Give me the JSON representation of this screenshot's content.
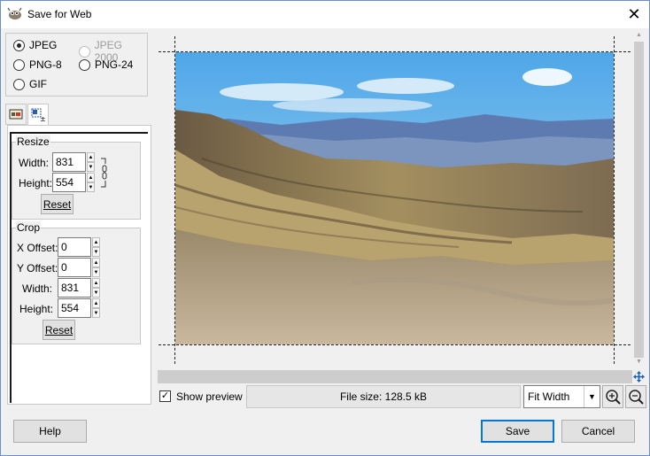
{
  "window": {
    "title": "Save for Web"
  },
  "format": {
    "options": [
      {
        "label": "JPEG",
        "checked": true,
        "disabled": false
      },
      {
        "label": "JPEG 2000",
        "checked": false,
        "disabled": true
      },
      {
        "label": "PNG-8",
        "checked": false,
        "disabled": false
      },
      {
        "label": "PNG-24",
        "checked": false,
        "disabled": false
      },
      {
        "label": "GIF",
        "checked": false,
        "disabled": false
      }
    ]
  },
  "resize": {
    "title": "Resize",
    "width_label": "Width:",
    "width_value": "831",
    "height_label": "Height:",
    "height_value": "554",
    "reset_label": "Reset"
  },
  "crop": {
    "title": "Crop",
    "x_label": "X Offset:",
    "x_value": "0",
    "y_label": "Y Offset:",
    "y_value": "0",
    "width_label": "Width:",
    "width_value": "831",
    "height_label": "Height:",
    "height_value": "554",
    "reset_label": "Reset"
  },
  "preview": {
    "show_label": "Show preview",
    "show_checked": true,
    "file_size": "File size: 128.5 kB",
    "zoom_value": "Fit Width"
  },
  "buttons": {
    "help": "Help",
    "save": "Save",
    "cancel": "Cancel"
  },
  "icons": {
    "app": "gimp-icon",
    "close": "close-icon",
    "zoom_in": "zoom-in-icon",
    "zoom_out": "zoom-out-icon",
    "move": "move-icon",
    "chain": "chain-link-icon"
  }
}
